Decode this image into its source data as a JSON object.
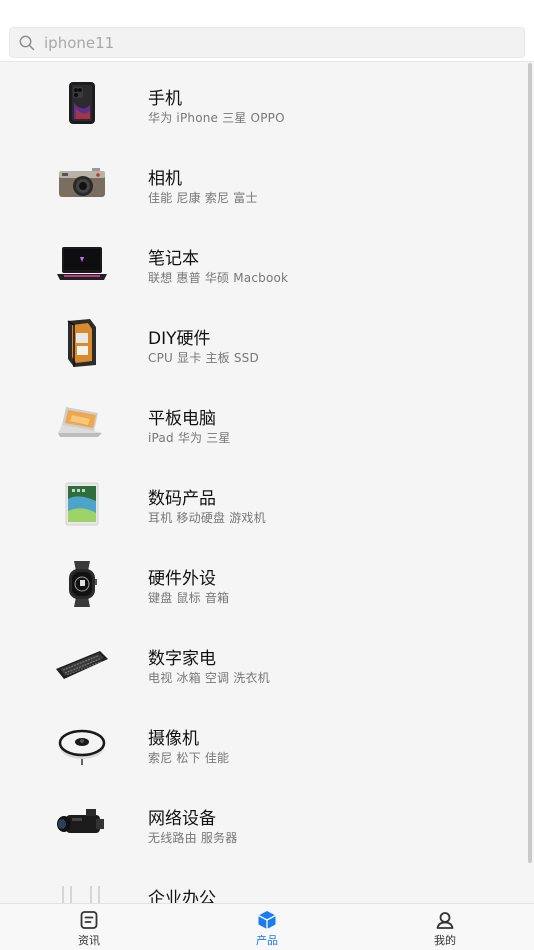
{
  "search": {
    "placeholder": "iphone11"
  },
  "categories": [
    {
      "title": "手机",
      "sub": "华为  iPhone  三星  OPPO",
      "icon": "phone-icon"
    },
    {
      "title": "相机",
      "sub": "佳能  尼康  索尼  富士",
      "icon": "camera-icon"
    },
    {
      "title": "笔记本",
      "sub": "联想  惠普  华硕  Macbook",
      "icon": "laptop-icon"
    },
    {
      "title": "DIY硬件",
      "sub": "CPU  显卡  主板  SSD",
      "icon": "pc-case-icon"
    },
    {
      "title": "平板电脑",
      "sub": "iPad  华为  三星",
      "icon": "convertible-laptop-icon"
    },
    {
      "title": "数码产品",
      "sub": "耳机  移动硬盘  游戏机",
      "icon": "tablet-icon"
    },
    {
      "title": "硬件外设",
      "sub": "键盘  鼠标  音箱",
      "icon": "smartwatch-icon"
    },
    {
      "title": "数字家电",
      "sub": "电视  冰箱  空调  洗衣机",
      "icon": "keyboard-icon"
    },
    {
      "title": "摄像机",
      "sub": "索尼  松下  佳能",
      "icon": "robot-vacuum-icon"
    },
    {
      "title": "网络设备",
      "sub": "无线路由  服务器",
      "icon": "camcorder-icon"
    },
    {
      "title": "企业办公",
      "sub": "",
      "icon": "office-icon"
    }
  ],
  "tabs": [
    {
      "label": "资讯",
      "icon": "news-icon",
      "active": false
    },
    {
      "label": "产品",
      "icon": "product-cube-icon",
      "active": true
    },
    {
      "label": "我的",
      "icon": "profile-icon",
      "active": false
    }
  ],
  "colors": {
    "accent": "#1a7cf0",
    "background": "#f5f5f5"
  }
}
